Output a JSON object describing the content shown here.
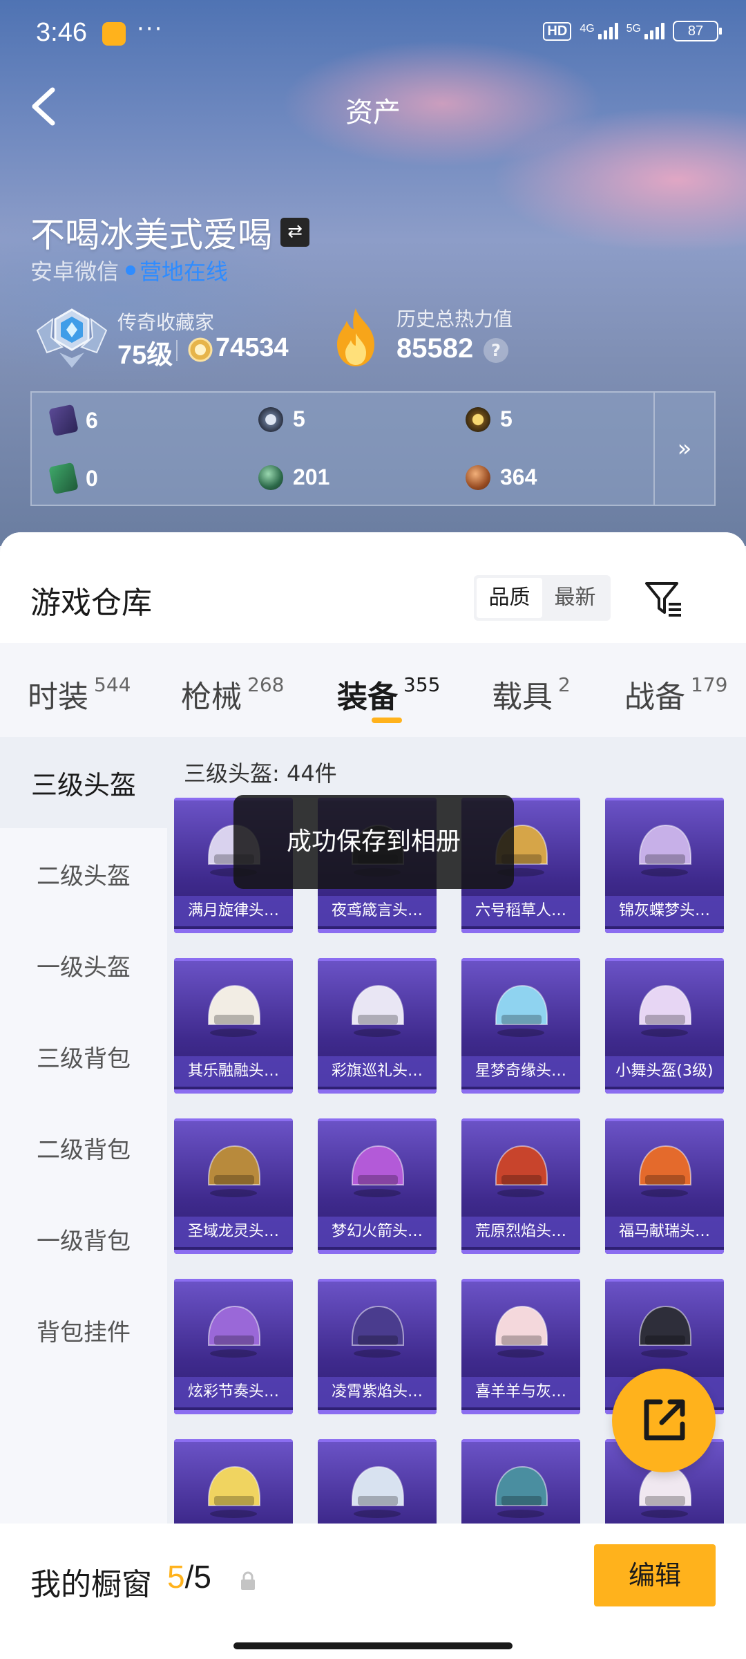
{
  "status_bar": {
    "time": "3:46",
    "dots": "···",
    "hd": "HD",
    "net1": "4G",
    "net2": "5G",
    "battery": "87"
  },
  "header": {
    "title": "资产"
  },
  "profile": {
    "name": "不喝冰美式爱喝",
    "platform": "安卓微信",
    "status": "营地在线",
    "rank_title": "传奇收藏家",
    "level": "75级",
    "coins": "74534",
    "heat_label": "历史总热力值",
    "heat_value": "85582",
    "help": "?"
  },
  "assets": {
    "items": [
      {
        "value": "6",
        "icon": "card-icon"
      },
      {
        "value": "5",
        "icon": "silver-medal-icon"
      },
      {
        "value": "5",
        "icon": "gold-medal-icon"
      },
      {
        "value": "0",
        "icon": "green-card-icon"
      },
      {
        "value": "201",
        "icon": "green-orb-icon"
      },
      {
        "value": "364",
        "icon": "bronze-orb-icon"
      }
    ],
    "more": "»"
  },
  "warehouse": {
    "title": "游戏仓库",
    "sort_options": [
      "品质",
      "最新"
    ],
    "sort_selected": "品质"
  },
  "tabs": [
    {
      "label": "时装",
      "count": "544"
    },
    {
      "label": "枪械",
      "count": "268"
    },
    {
      "label": "装备",
      "count": "355"
    },
    {
      "label": "载具",
      "count": "2"
    },
    {
      "label": "战备",
      "count": "179"
    }
  ],
  "active_tab": "装备",
  "categories": [
    "三级头盔",
    "二级头盔",
    "一级头盔",
    "三级背包",
    "二级背包",
    "一级背包",
    "背包挂件"
  ],
  "active_category": "三级头盔",
  "grid": {
    "title": "三级头盔: 44件",
    "items": [
      {
        "name": "满月旋律头…",
        "color": "#d9d2ee"
      },
      {
        "name": "夜鸢箴言头…",
        "color": "#3b3a48"
      },
      {
        "name": "六号稻草人…",
        "color": "#d6a548"
      },
      {
        "name": "锦灰蝶梦头…",
        "color": "#c7b0e8"
      },
      {
        "name": "其乐融融头…",
        "color": "#f2ede4"
      },
      {
        "name": "彩旗巡礼头…",
        "color": "#e9e6f4"
      },
      {
        "name": "星梦奇缘头…",
        "color": "#8fd3f0"
      },
      {
        "name": "小舞头盔(3级)",
        "color": "#e7d6f4"
      },
      {
        "name": "圣域龙灵头…",
        "color": "#b88a3c"
      },
      {
        "name": "梦幻火箭头…",
        "color": "#b35ad8"
      },
      {
        "name": "荒原烈焰头…",
        "color": "#c8442c"
      },
      {
        "name": "福马献瑞头…",
        "color": "#e46a2c"
      },
      {
        "name": "炫彩节奏头…",
        "color": "#9a68d8"
      },
      {
        "name": "凌霄紫焰头…",
        "color": "#4a3c8e"
      },
      {
        "name": "喜羊羊与灰…",
        "color": "#f4d8dc"
      },
      {
        "name": "",
        "color": "#2e2e3a"
      },
      {
        "name": "",
        "color": "#f0d460"
      },
      {
        "name": "",
        "color": "#d8e2f0"
      },
      {
        "name": "",
        "color": "#4a8ea0"
      },
      {
        "name": "",
        "color": "#f0e8f0"
      }
    ]
  },
  "toast": "成功保存到相册",
  "showcase": {
    "label": "我的橱窗",
    "current": "5",
    "total": "/5",
    "edit": "编辑"
  },
  "colors": {
    "accent": "#ffb21c",
    "link": "#2f8cff",
    "card_purple": "#3f2a8d"
  }
}
